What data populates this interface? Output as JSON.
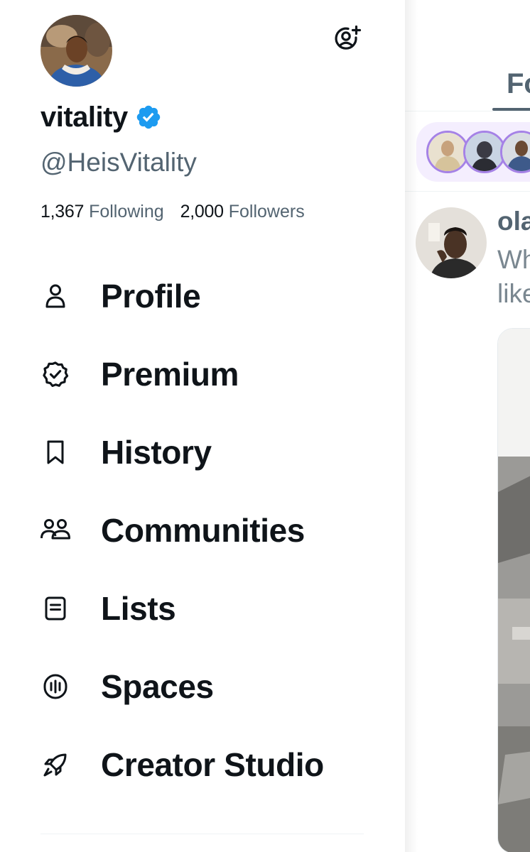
{
  "account": {
    "display_name": "vitality",
    "handle": "@HeisVitality",
    "verified": true,
    "following_count": "1,367",
    "following_label": "Following",
    "followers_count": "2,000",
    "followers_label": "Followers"
  },
  "header_actions": {
    "add_account_icon": "person-plus-icon"
  },
  "nav": {
    "items": [
      {
        "label": "Profile",
        "icon": "person-icon"
      },
      {
        "label": "Premium",
        "icon": "verified-badge-icon"
      },
      {
        "label": "History",
        "icon": "bookmark-icon"
      },
      {
        "label": "Communities",
        "icon": "people-icon"
      },
      {
        "label": "Lists",
        "icon": "list-icon"
      },
      {
        "label": "Spaces",
        "icon": "microphone-icon"
      },
      {
        "label": "Creator Studio",
        "icon": "rocket-icon"
      }
    ]
  },
  "timeline": {
    "active_tab": "Fo",
    "post": {
      "author_partial": "ola",
      "text_line1": "Wh",
      "text_line2": "like"
    }
  },
  "colors": {
    "text_primary": "#0f1419",
    "text_secondary": "#536471",
    "verified_blue": "#1d9bf0",
    "fleet_ring": "#a582e6",
    "fleet_bg": "#f4eefe"
  }
}
